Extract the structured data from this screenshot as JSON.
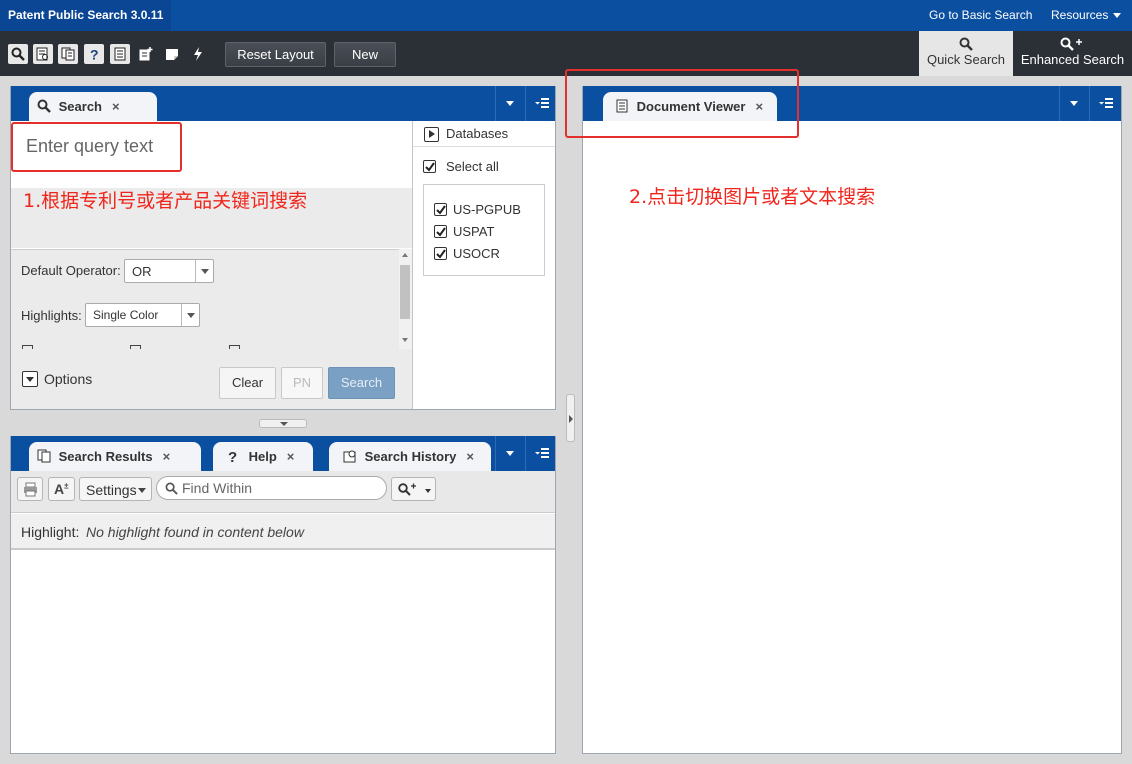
{
  "app": {
    "title": "Patent Public Search 3.0.11",
    "links": {
      "basic": "Go to Basic Search",
      "resources": "Resources"
    }
  },
  "toolbar": {
    "reset_label": "Reset Layout",
    "new_label": "New",
    "quick_search": "Quick Search",
    "enhanced_search": "Enhanced Search",
    "icons": [
      "search-icon",
      "search-form-icon",
      "documents-icon",
      "help-icon",
      "notes-icon",
      "new-doc-icon",
      "note-icon",
      "lightning-icon"
    ]
  },
  "search_panel": {
    "tab_label": "Search",
    "close": "×",
    "query_placeholder": "Enter query text",
    "default_operator_label": "Default Operator:",
    "default_operator_value": "OR",
    "highlights_label": "Highlights:",
    "highlights_value": "Single Color",
    "options_label": "Options",
    "buttons": {
      "clear": "Clear",
      "pn": "PN",
      "search": "Search"
    },
    "databases": {
      "title": "Databases",
      "select_all": "Select all",
      "items": [
        "US-PGPUB",
        "USPAT",
        "USOCR"
      ]
    }
  },
  "results_panel": {
    "tabs": [
      {
        "label": "Search Results",
        "close": "×"
      },
      {
        "label": "Help",
        "close": "×"
      },
      {
        "label": "Search History",
        "close": "×"
      }
    ],
    "settings_label": "Settings",
    "find_placeholder": "Find Within",
    "highlight_label": "Highlight:",
    "highlight_message": "No highlight found in content below"
  },
  "viewer_panel": {
    "tab_label": "Document Viewer",
    "close": "×"
  },
  "annotations": {
    "note1": "1.根据专利号或者产品关键词搜索",
    "note2": "2.点击切换图片或者文本搜索",
    "color": "#e3302d"
  },
  "colors": {
    "brand_blue": "#0b4fa0",
    "toolbar_dark": "#2b2f36",
    "primary_button": "#7aa0c4"
  }
}
